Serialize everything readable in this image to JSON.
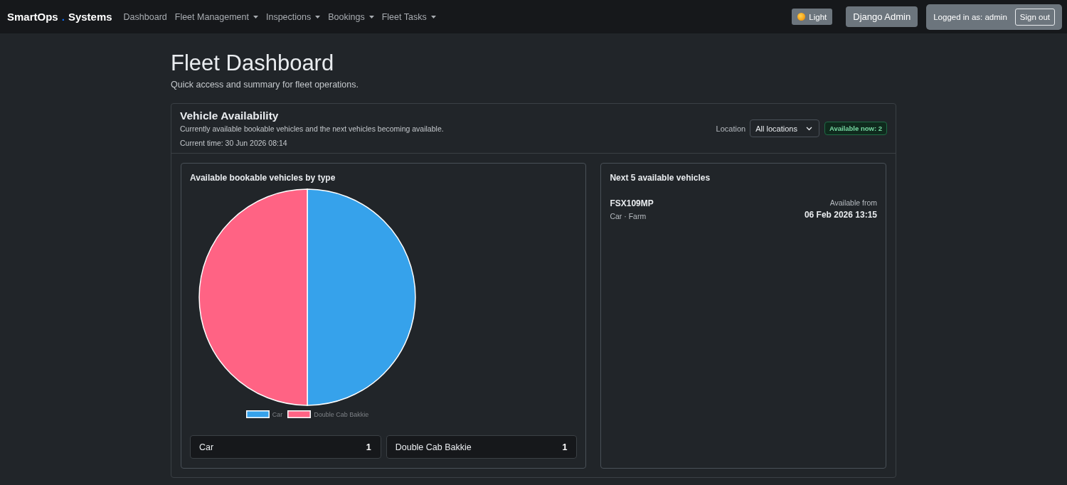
{
  "navbar": {
    "brand": {
      "name": "SmartOps",
      "separator": ".",
      "suffix": "Systems"
    },
    "menu": [
      {
        "label": "Dashboard",
        "dropdown": false
      },
      {
        "label": "Fleet Management",
        "dropdown": true
      },
      {
        "label": "Inspections",
        "dropdown": true
      },
      {
        "label": "Bookings",
        "dropdown": true
      },
      {
        "label": "Fleet Tasks",
        "dropdown": true
      }
    ],
    "theme_button": {
      "label": "Light"
    },
    "admin_button": {
      "label": "Django Admin"
    },
    "user": {
      "text": "Logged in as: admin",
      "sign_out": "Sign out"
    }
  },
  "page": {
    "title": "Fleet Dashboard",
    "subtitle": "Quick access and summary for fleet operations."
  },
  "vehicle_availability": {
    "title": "Vehicle Availability",
    "description": "Currently available bookable vehicles and the next vehicles becoming available.",
    "current_time": "Current time: 30 Jun 2026 08:14",
    "location_label": "Location",
    "location_select": {
      "value": "All locations"
    },
    "available_badge": "Available now: 2",
    "by_type": {
      "title": "Available bookable vehicles by type",
      "chart_data": {
        "type": "pie",
        "categories": [
          "Car",
          "Double Cab Bakkie"
        ],
        "values": [
          50,
          50
        ],
        "colors": [
          "#36a2eb",
          "#ff6384"
        ],
        "legend": "bottom"
      },
      "counts": [
        {
          "type": "Car",
          "count": "1"
        },
        {
          "type": "Double Cab Bakkie",
          "count": "1"
        }
      ]
    },
    "next_available": {
      "title": "Next 5 available vehicles",
      "vehicles": [
        {
          "registration": "FSX109MP",
          "details": "Car · Farm",
          "available_label": "Available from",
          "available_from": "06 Feb 2026 13:15"
        }
      ]
    }
  }
}
